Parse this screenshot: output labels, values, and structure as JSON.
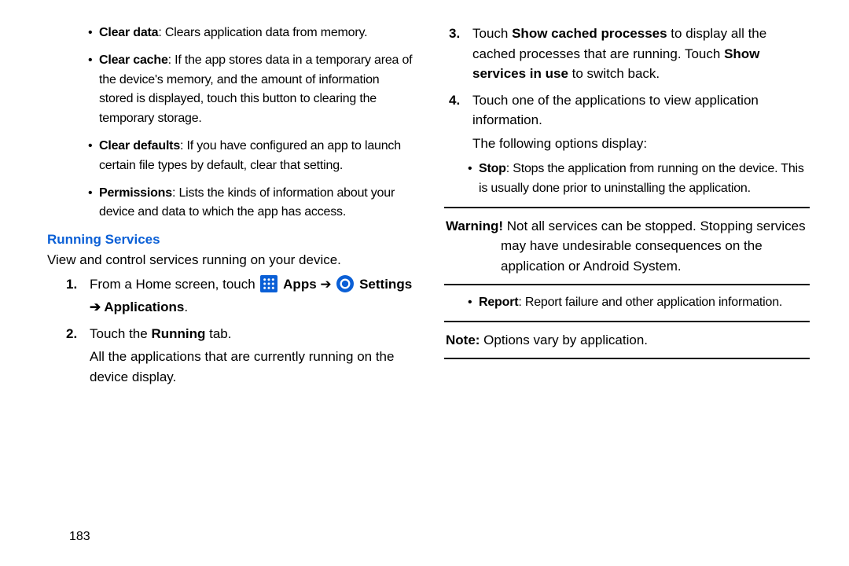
{
  "page_number": "183",
  "left": {
    "bullets": [
      {
        "term": "Clear data",
        "desc": ": Clears application data from memory."
      },
      {
        "term": "Clear cache",
        "desc": ": If the app stores data in a temporary area of the device's memory, and the amount of information stored is displayed, touch this button to clearing the temporary storage."
      },
      {
        "term": "Clear defaults",
        "desc": ": If you have configured an app to launch certain file types by default, clear that setting."
      },
      {
        "term": "Permissions",
        "desc": ": Lists the kinds of information about your device and data to which the app has access."
      }
    ],
    "heading": "Running Services",
    "intro": "View and control services running on your device.",
    "step1_pre": "From a Home screen, touch ",
    "step1_apps": "Apps",
    "step1_arrow": " ➔ ",
    "step1_settings": "Settings",
    "step1_line2_arrow": "➔ ",
    "step1_applications": "Applications",
    "step1_dot": ".",
    "step2_pre": "Touch the ",
    "step2_bold": "Running",
    "step2_post": " tab.",
    "step2_sub": "All the applications that are currently running on the device display."
  },
  "right": {
    "step3_pre": "Touch ",
    "step3_b1": "Show cached processes",
    "step3_mid": " to display all the cached processes that are running. Touch ",
    "step3_b2": "Show services in use",
    "step3_post": " to switch back.",
    "step4_text": "Touch one of the applications to view application information.",
    "step4_sub": "The following options display:",
    "stop_term": "Stop",
    "stop_desc": ": Stops the application from running on the device. This is usually done prior to uninstalling the application.",
    "warning_lead": "Warning!",
    "warning_first": " Not all services can be stopped. Stopping services",
    "warning_rest": "may have undesirable consequences on the application or Android System.",
    "report_term": "Report",
    "report_desc": ": Report failure and other application information.",
    "note_lead": "Note:",
    "note_text": " Options vary by application."
  }
}
